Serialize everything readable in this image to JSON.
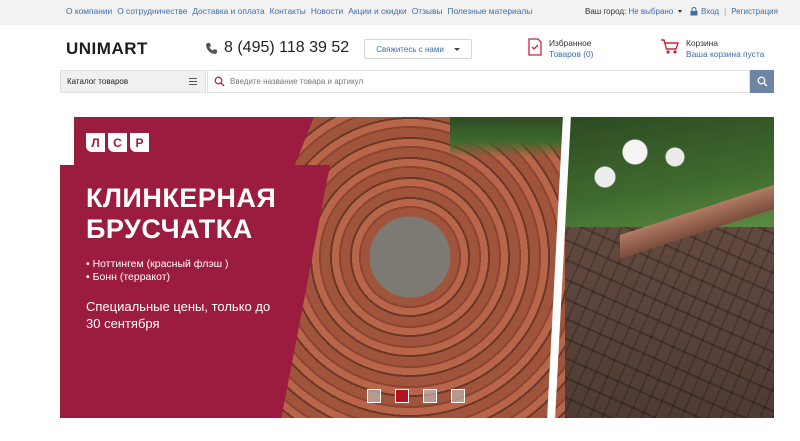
{
  "topbar": {
    "links": [
      "О компании",
      "О сотрудничестве",
      "Доставка и оплата",
      "Контакты",
      "Новости",
      "Акции и скидки",
      "Отзывы",
      "Полезные материалы"
    ],
    "city_label": "Ваш город:",
    "city_value": "Не выбрано",
    "login": "Вход",
    "register": "Регистрация"
  },
  "header": {
    "logo": "UNIMART",
    "phone": "8 (495) 118 39 52",
    "callback_label": "Свяжитесь с нами",
    "favorites_title": "Избранное",
    "favorites_count": "Товаров (0)",
    "cart_title": "Корзина",
    "cart_status": "Ваша корзина пуста"
  },
  "search": {
    "catalog_label": "Каталог товаров",
    "placeholder": "Введите название товара и артикул"
  },
  "banner": {
    "brand_letters": [
      "Л",
      "С",
      "Р"
    ],
    "title": "КЛИНКЕРНАЯ БРУСЧАТКА",
    "items": [
      "• Ноттингем (красный флэш )",
      "• Бонн (терракот)"
    ],
    "offer": "Специальные цены, только до 30 сентября",
    "slide_count": 4,
    "active_slide": 2
  },
  "colors": {
    "accent_red": "#9b1c3f",
    "link_blue": "#3f6ea8",
    "search_button": "#6e85a6"
  }
}
